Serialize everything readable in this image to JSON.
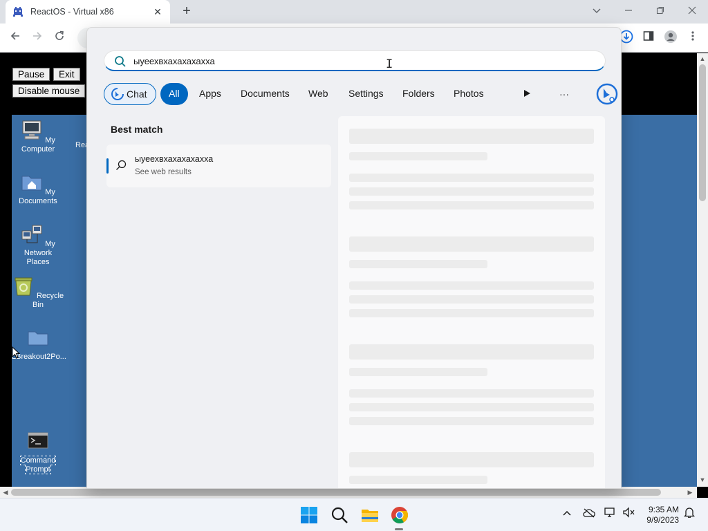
{
  "browser": {
    "tab_title": "ReactOS - Virtual x86",
    "tab_close": "✕",
    "new_tab": "+"
  },
  "vm": {
    "buttons": {
      "pause": "Pause",
      "exit": "Exit",
      "disable_mouse": "Disable mouse"
    },
    "desktop_icons": [
      {
        "label": "My Computer"
      },
      {
        "label": "My Documents"
      },
      {
        "label": "My Network Places"
      },
      {
        "label": "Recycle Bin"
      },
      {
        "label": "LBreakout2Po..."
      },
      {
        "label": "Command Prompt"
      }
    ],
    "partial_window_label": "Rea"
  },
  "search": {
    "query": "ыуеехвхахахахахха",
    "filters": [
      "Chat",
      "All",
      "Apps",
      "Documents",
      "Web",
      "Settings",
      "Folders",
      "Photos"
    ],
    "active_filter": "All",
    "more_label": "···",
    "best_match_label": "Best match",
    "result": {
      "title": "ыуеехвхахахахахха",
      "subtitle": "See web results"
    }
  },
  "taskbar": {
    "time": "9:35 AM",
    "date": "9/9/2023",
    "tray_chevron": "^"
  },
  "colors": {
    "accent": "#0067c0",
    "desktop": "#3a6ea5"
  }
}
